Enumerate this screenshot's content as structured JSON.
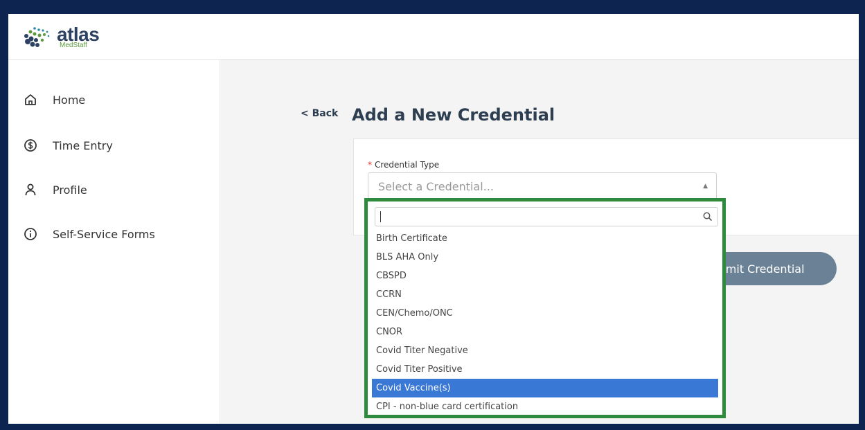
{
  "brand": {
    "name": "atlas",
    "sub": "MedStaff",
    "colors": {
      "navy": "#2d4263",
      "green": "#5a9a3c",
      "teal": "#2a8aa8"
    }
  },
  "sidebar": {
    "items": [
      {
        "label": "Home",
        "icon": "home-icon"
      },
      {
        "label": "Time Entry",
        "icon": "dollar-circle-icon"
      },
      {
        "label": "Profile",
        "icon": "user-icon"
      },
      {
        "label": "Self-Service Forms",
        "icon": "info-circle-icon"
      }
    ]
  },
  "page": {
    "back_label": "< Back",
    "title": "Add a New Credential"
  },
  "form": {
    "required_mark": "*",
    "credential_type_label": "Credential Type",
    "credential_type_placeholder": "Select a Credential...",
    "submit_label": "Submit Credential",
    "submit_visible_label": "omit Credential"
  },
  "dropdown": {
    "search_value": "",
    "highlight_color": "#3a78d6",
    "outline_color": "#2e8b3e",
    "options": [
      "Birth Certificate",
      "BLS AHA Only",
      "CBSPD",
      "CCRN",
      "CEN/Chemo/ONC",
      "CNOR",
      "Covid Titer Negative",
      "Covid Titer Positive",
      "Covid Vaccine(s)",
      "CPI - non-blue card certification"
    ],
    "highlighted_option": "Covid Vaccine(s)"
  }
}
